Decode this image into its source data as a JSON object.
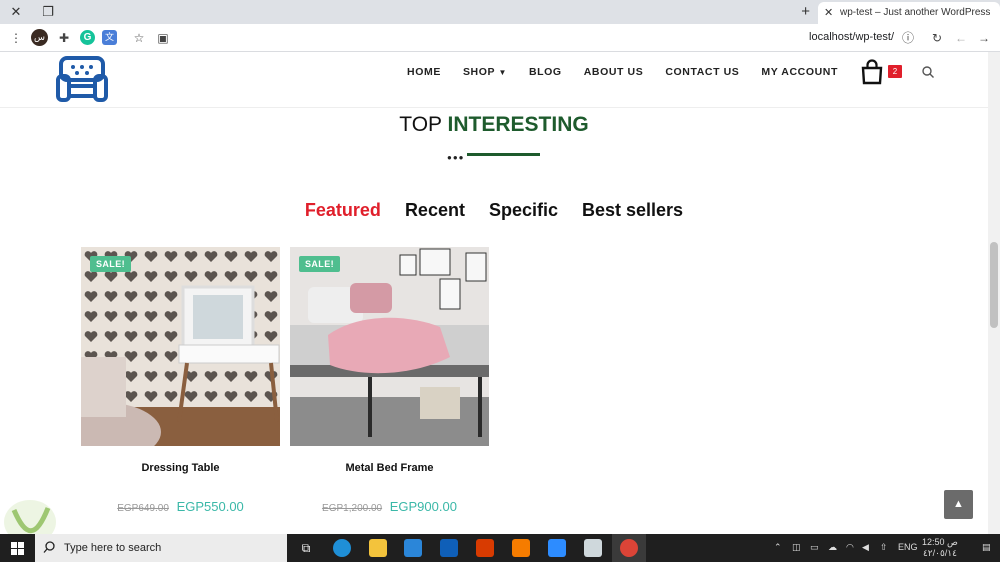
{
  "browser": {
    "tab_title": "wp-test – Just another WordPress",
    "url": "localhost/wp-test/",
    "profile_initial": "س"
  },
  "nav": {
    "items": [
      "HOME",
      "SHOP",
      "BLOG",
      "ABOUT US",
      "CONTACT US",
      "MY ACCOUNT"
    ],
    "cart_count": "2"
  },
  "section": {
    "title_plain": "TOP",
    "title_accent": "INTERESTING"
  },
  "tabs": [
    "Featured",
    "Recent",
    "Specific",
    "Best sellers"
  ],
  "products": [
    {
      "badge": "SALE!",
      "name": "Dressing Table",
      "old_price": "EGP649.00",
      "new_price": "EGP550.00"
    },
    {
      "badge": "SALE!",
      "name": "Metal Bed Frame",
      "old_price": "EGP1,200.00",
      "new_price": "EGP900.00"
    }
  ],
  "taskbar": {
    "search_placeholder": "Type here to search",
    "lang": "ENG",
    "time": "12:50 ص",
    "date": "٤٢/٠٥/١٤"
  },
  "colors": {
    "accent_green": "#1e5b2d",
    "accent_red": "#e01f2b",
    "price_teal": "#3bb8a8",
    "sale_badge": "#4fbe8f"
  }
}
